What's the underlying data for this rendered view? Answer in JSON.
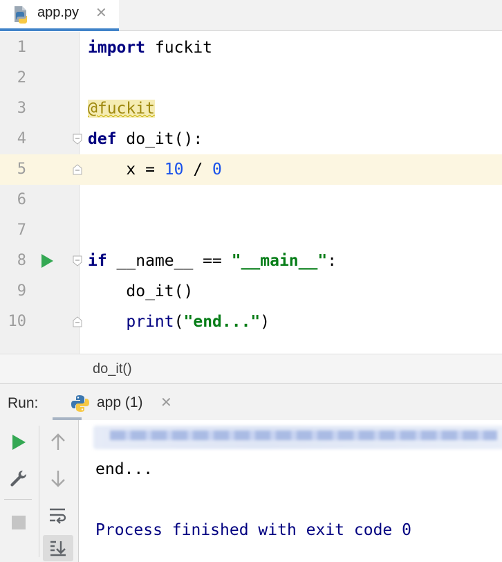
{
  "editor": {
    "tab": {
      "label": "app.py",
      "close": "✕"
    },
    "lines": [
      {
        "num": "1"
      },
      {
        "num": "2"
      },
      {
        "num": "3"
      },
      {
        "num": "4"
      },
      {
        "num": "5"
      },
      {
        "num": "6"
      },
      {
        "num": "7"
      },
      {
        "num": "8"
      },
      {
        "num": "9"
      },
      {
        "num": "10"
      }
    ],
    "code": {
      "l1_kw": "import",
      "l1_rest": " fuckit",
      "l3_deco": "@fuckit",
      "l4_kw": "def",
      "l4_rest": " do_it():",
      "l5_a": "    x = ",
      "l5_n1": "10",
      "l5_b": " / ",
      "l5_n2": "0",
      "l8_kw": "if",
      "l8_a": " __name__ == ",
      "l8_str": "\"__main__\"",
      "l8_b": ":",
      "l9": "    do_it()",
      "l10_a": "    ",
      "l10_fn": "print",
      "l10_b": "(",
      "l10_str": "\"end...\"",
      "l10_c": ")"
    },
    "breadcrumb": "do_it()"
  },
  "run": {
    "title": "Run:",
    "tab_label": "app (1)",
    "tab_close": "✕",
    "output": {
      "line1": "end...",
      "line2": "Process finished with exit code 0"
    }
  },
  "colors": {
    "keyword": "#000080",
    "number": "#1750eb",
    "string": "#067d17",
    "decorator": "#9e880d",
    "run_green": "#34a853",
    "console_output": "#000080"
  }
}
